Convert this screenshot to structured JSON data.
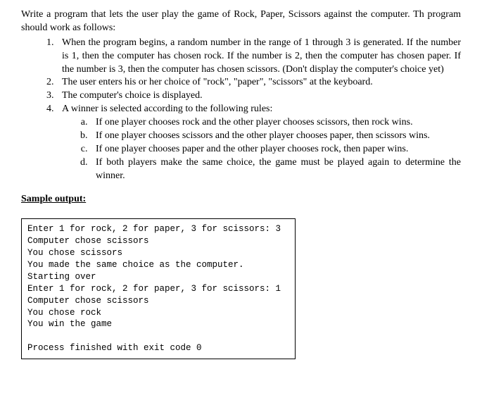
{
  "intro": "Write a program that lets the user play the game of Rock, Paper, Scissors against the computer. Th program should work as follows:",
  "steps": [
    "When the program begins, a random number in the range of 1 through 3 is generated. If the number is 1, then the computer has chosen rock. If the number is 2, then the computer has chosen paper. If the number is 3, then the computer has chosen scissors. (Don't display the computer's choice yet)",
    "The user enters his or her choice of \"rock\", \"paper\", \"scissors\" at the keyboard.",
    "The computer's choice is displayed.",
    "A winner is selected according to the following rules:"
  ],
  "rules": [
    "If one player chooses rock and the other player chooses scissors, then rock wins.",
    "If one player chooses scissors and the other player chooses paper, then scissors wins.",
    "If one player chooses paper and the other player chooses rock, then paper wins.",
    "If both players make the same choice, the game must be played again to determine the winner."
  ],
  "sample_heading": "Sample output:",
  "sample_output": "Enter 1 for rock, 2 for paper, 3 for scissors: 3\nComputer chose scissors\nYou chose scissors\nYou made the same choice as the computer. Starting over\nEnter 1 for rock, 2 for paper, 3 for scissors: 1\nComputer chose scissors\nYou chose rock\nYou win the game\n\nProcess finished with exit code 0"
}
